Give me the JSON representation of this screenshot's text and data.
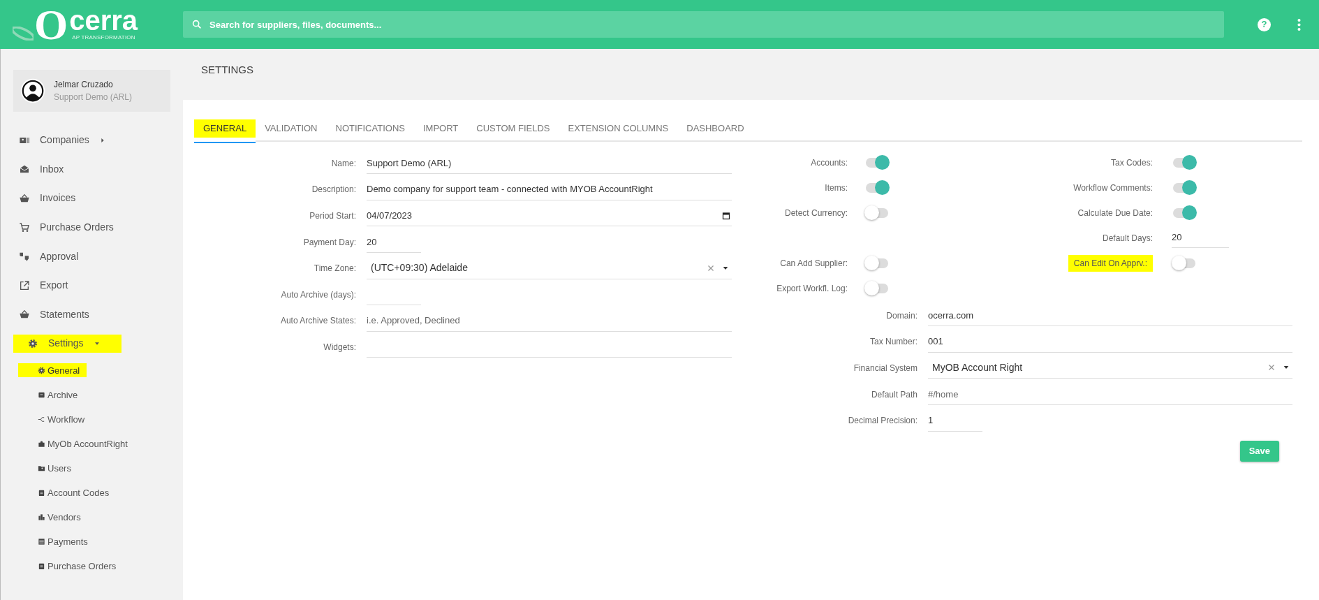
{
  "header": {
    "logo_word": "cerra",
    "logo_initial": "O",
    "logo_tagline": "AP TRANSFORMATION",
    "search": {
      "placeholder": "Search for suppliers, files, documents..."
    },
    "help": "?"
  },
  "user": {
    "name": "Jelmar Cruzado",
    "company": "Support Demo (ARL)"
  },
  "sidebar": {
    "items": [
      {
        "label": "Companies",
        "has_submenu": true,
        "expanded": false,
        "highlighted": false
      },
      {
        "label": "Inbox",
        "has_submenu": false,
        "highlighted": false
      },
      {
        "label": "Invoices",
        "has_submenu": false,
        "highlighted": false
      },
      {
        "label": "Purchase Orders",
        "has_submenu": false,
        "highlighted": false
      },
      {
        "label": "Approval",
        "has_submenu": false,
        "highlighted": false
      },
      {
        "label": "Export",
        "has_submenu": false,
        "highlighted": false
      },
      {
        "label": "Statements",
        "has_submenu": false,
        "highlighted": false
      },
      {
        "label": "Settings",
        "has_submenu": true,
        "expanded": true,
        "highlighted": true,
        "children": [
          {
            "label": "General",
            "selected": true,
            "highlighted": true
          },
          {
            "label": "Archive",
            "selected": false,
            "highlighted": false
          },
          {
            "label": "Workflow",
            "selected": false,
            "highlighted": false
          },
          {
            "label": "MyOb AccountRight",
            "selected": false,
            "highlighted": false
          },
          {
            "label": "Users",
            "selected": false,
            "highlighted": false
          },
          {
            "label": "Account Codes",
            "selected": false,
            "highlighted": false
          },
          {
            "label": "Vendors",
            "selected": false,
            "highlighted": false
          },
          {
            "label": "Payments",
            "selected": false,
            "highlighted": false
          },
          {
            "label": "Purchase Orders",
            "selected": false,
            "highlighted": false
          }
        ]
      }
    ]
  },
  "page_title": "SETTINGS",
  "tabs": [
    {
      "label": "GENERAL",
      "selected": true,
      "highlighted": true
    },
    {
      "label": "VALIDATION",
      "selected": false,
      "highlighted": false
    },
    {
      "label": "NOTIFICATIONS",
      "selected": false,
      "highlighted": false
    },
    {
      "label": "IMPORT",
      "selected": false,
      "highlighted": false
    },
    {
      "label": "CUSTOM FIELDS",
      "selected": false,
      "highlighted": false
    },
    {
      "label": "EXTENSION COLUMNS",
      "selected": false,
      "highlighted": false
    },
    {
      "label": "DASHBOARD",
      "selected": false,
      "highlighted": false
    }
  ],
  "general_fields": [
    {
      "label": "Name:",
      "kind": "text",
      "value": "Support Demo (ARL)"
    },
    {
      "label": "Description:",
      "kind": "text",
      "value": "Demo company for support team - connected with MYOB AccountRight"
    },
    {
      "label": "Period Start:",
      "kind": "date",
      "value": "04/07/2023"
    },
    {
      "label": "Payment Day:",
      "kind": "short",
      "value": "20"
    },
    {
      "label": "Time Zone:",
      "kind": "select",
      "value": "(UTC+09:30) Adelaide"
    },
    {
      "label": "Auto Archive (days):",
      "kind": "short"
    },
    {
      "label": "Auto Archive States:",
      "kind": "text",
      "placeholder": "i.e. Approved, Declined"
    },
    {
      "label": "Widgets:",
      "kind": "text"
    }
  ],
  "option_rows": [
    {
      "left": {
        "label": "Accounts:",
        "kind": "toggle",
        "on": true
      },
      "right": {
        "label": "Tax Codes:",
        "kind": "toggle",
        "on": true,
        "highlighted": false
      }
    },
    {
      "left": {
        "label": "Items:",
        "kind": "toggle",
        "on": true
      },
      "right": {
        "label": "Workflow Comments:",
        "kind": "toggle",
        "on": true,
        "highlighted": false
      }
    },
    {
      "left": {
        "label": "Detect Currency:",
        "kind": "toggle",
        "on": false
      },
      "right": {
        "label": "Calculate Due Date:",
        "kind": "toggle",
        "on": true,
        "highlighted": false
      }
    },
    {
      "right": {
        "label": "Default Days:",
        "kind": "input",
        "value": "20",
        "highlighted": false
      }
    },
    {
      "left": {
        "label": "Can Add Supplier:",
        "kind": "toggle",
        "on": false
      },
      "right": {
        "label": "Can Edit On Apprv.:",
        "kind": "toggle",
        "on": false,
        "highlighted": true
      }
    },
    {
      "left": {
        "label": "Export Workfl. Log:",
        "kind": "toggle",
        "on": false
      }
    }
  ],
  "system_fields": [
    {
      "label": "Domain:",
      "kind": "text",
      "value": "ocerra.com"
    },
    {
      "label": "Tax Number:",
      "kind": "text",
      "value": "001"
    },
    {
      "label": "Financial System",
      "kind": "select",
      "value": "MyOB Account Right"
    },
    {
      "label": "Default Path",
      "kind": "text",
      "placeholder": "#/home"
    },
    {
      "label": "Decimal Precision:",
      "kind": "short",
      "value": "1"
    }
  ],
  "save_button": "Save"
}
